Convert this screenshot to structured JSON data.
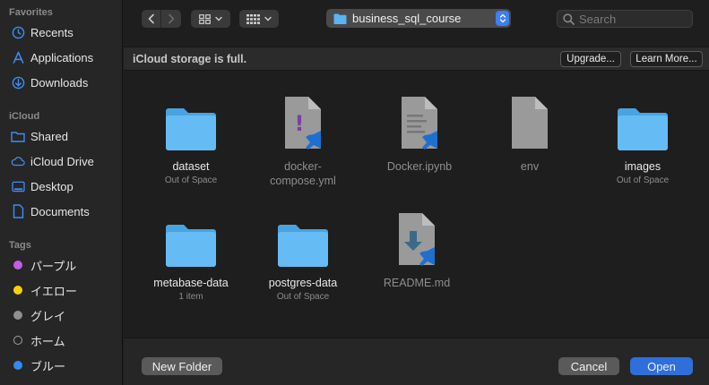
{
  "sidebar": {
    "favorites_heading": "Favorites",
    "favorites": [
      {
        "label": "Recents",
        "icon": "clock-icon"
      },
      {
        "label": "Applications",
        "icon": "applications-icon"
      },
      {
        "label": "Downloads",
        "icon": "download-icon"
      }
    ],
    "icloud_heading": "iCloud",
    "icloud": [
      {
        "label": "Shared",
        "icon": "shared-folder-icon"
      },
      {
        "label": "iCloud Drive",
        "icon": "cloud-icon"
      },
      {
        "label": "Desktop",
        "icon": "desktop-icon"
      },
      {
        "label": "Documents",
        "icon": "document-icon"
      }
    ],
    "tags_heading": "Tags",
    "tags": [
      {
        "label": "パープル",
        "color": "#c25ee8"
      },
      {
        "label": "イエロー",
        "color": "#f5d20a"
      },
      {
        "label": "グレイ",
        "color": "#8e8e93"
      },
      {
        "label": "ホーム",
        "color": "none"
      },
      {
        "label": "ブルー",
        "color": "#2f8bf5"
      }
    ]
  },
  "toolbar": {
    "location": "business_sql_course",
    "search_placeholder": "Search"
  },
  "banner": {
    "message": "iCloud storage is full.",
    "upgrade_label": "Upgrade...",
    "learn_more_label": "Learn More..."
  },
  "files": [
    {
      "name": "dataset",
      "sub": "Out of Space",
      "type": "folder",
      "dim": false
    },
    {
      "name": "docker-\ncompose.yml",
      "sub": "",
      "type": "yml",
      "dim": true
    },
    {
      "name": "Docker.ipynb",
      "sub": "",
      "type": "ipynb",
      "dim": true
    },
    {
      "name": "env",
      "sub": "",
      "type": "blank",
      "dim": true
    },
    {
      "name": "images",
      "sub": "Out of Space",
      "type": "folder",
      "dim": false
    },
    {
      "name": "metabase-data",
      "sub": "1 item",
      "type": "folder",
      "dim": false
    },
    {
      "name": "postgres-data",
      "sub": "Out of Space",
      "type": "folder",
      "dim": false
    },
    {
      "name": "README.md",
      "sub": "",
      "type": "md",
      "dim": true
    }
  ],
  "footer": {
    "new_folder_label": "New Folder",
    "cancel_label": "Cancel",
    "open_label": "Open"
  },
  "colors": {
    "accent": "#2f6fdb",
    "folder": "#5ab4f2",
    "sidebar_icon": "#3d8ef6"
  }
}
